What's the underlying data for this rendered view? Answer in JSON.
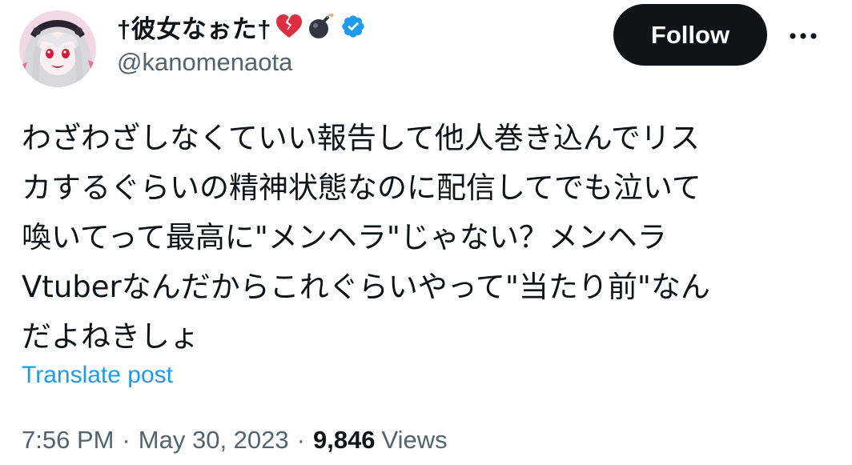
{
  "author": {
    "display_name": "†彼女なぉた†",
    "emojis": [
      "broken-heart",
      "bomb"
    ],
    "verified": true,
    "handle": "@kanomenaota",
    "avatar_colors": {
      "hair": "#d8d8dc",
      "background": "#f2d8e6",
      "eyes": "#d01c3a",
      "accent": "#f06aa8"
    }
  },
  "follow_button": {
    "label": "Follow"
  },
  "more_button": {
    "icon": "more-horizontal-icon"
  },
  "post": {
    "text": "わざわざしなくていい報告して他人巻き込んでリス\nカするぐらいの精神状態なのに配信してでも泣いて\n喚いてって最高に\"メンヘラ\"じゃない？メンヘラ\nVtuberなんだからこれぐらいやって\"当たり前\"なん\nだよねきしょ",
    "translate_label": "Translate post"
  },
  "meta": {
    "time": "7:56 PM",
    "separator": "·",
    "date": "May 30, 2023",
    "views_count": "9,846",
    "views_label": "Views"
  },
  "colors": {
    "text_primary": "#0f1419",
    "text_secondary": "#536471",
    "link": "#1d9bf0",
    "verified_badge": "#1d9bf0",
    "button_bg": "#0f1419",
    "button_text": "#ffffff"
  }
}
